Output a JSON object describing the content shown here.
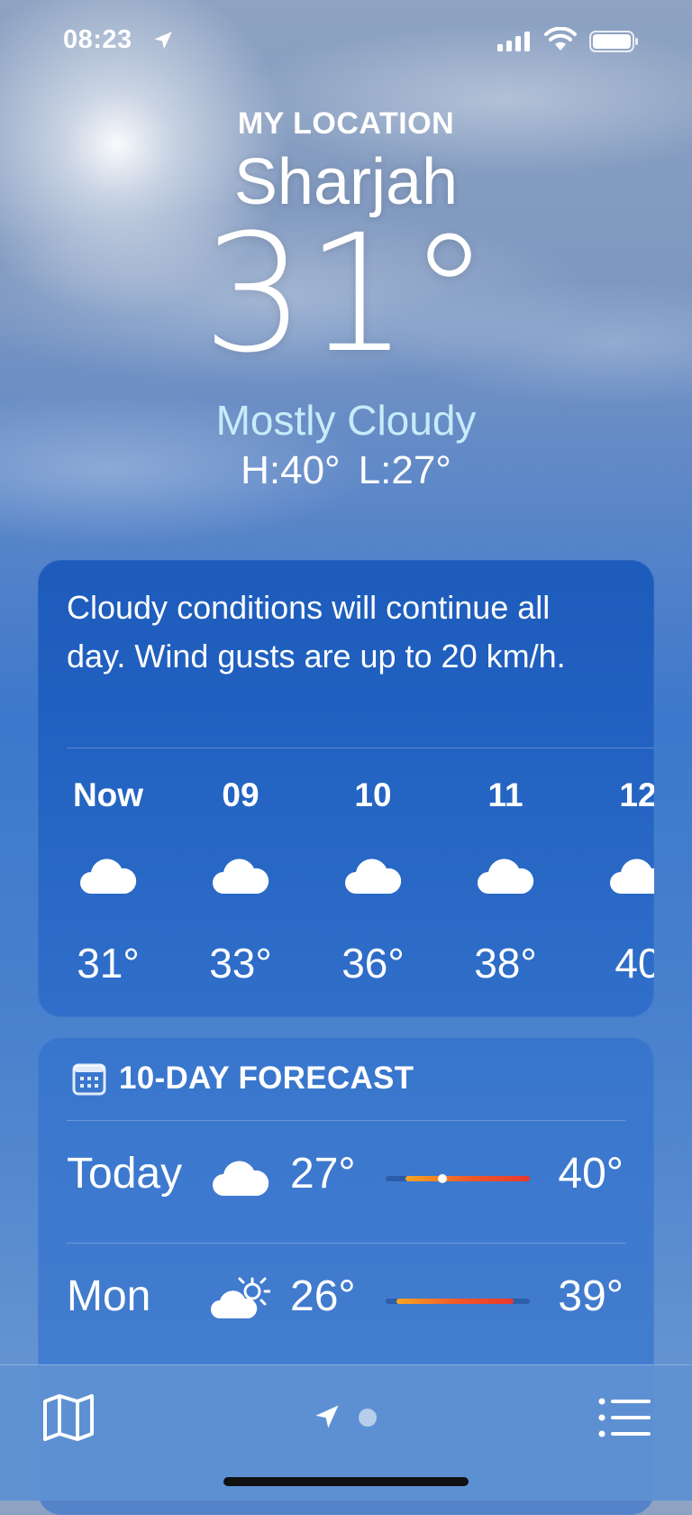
{
  "status_bar": {
    "time": "08:23",
    "icons": [
      "location-arrow-icon",
      "signal-icon",
      "wifi-icon",
      "battery-icon"
    ]
  },
  "header": {
    "location_label": "MY LOCATION",
    "city": "Sharjah",
    "temperature": "31°",
    "condition": "Mostly Cloudy",
    "high": "H:40°",
    "low": "L:27°"
  },
  "hourly_card": {
    "summary": "Cloudy conditions will continue all day. Wind gusts are up to 20 km/h.",
    "hours": [
      {
        "label": "Now",
        "icon": "cloud-icon",
        "temp": "31°"
      },
      {
        "label": "09",
        "icon": "cloud-icon",
        "temp": "33°"
      },
      {
        "label": "10",
        "icon": "cloud-icon",
        "temp": "36°"
      },
      {
        "label": "11",
        "icon": "cloud-icon",
        "temp": "38°"
      },
      {
        "label": "12",
        "icon": "cloud-icon",
        "temp": "40"
      }
    ]
  },
  "forecast_card": {
    "title": "10-DAY FORECAST",
    "icon": "calendar-icon",
    "days": [
      {
        "day": "Today",
        "icon": "cloud-icon",
        "low": "27°",
        "high": "40°",
        "current_marker": true
      },
      {
        "day": "Mon",
        "icon": "partly-sunny-icon",
        "low": "26°",
        "high": "39°",
        "current_marker": false
      }
    ]
  },
  "bottom_bar": {
    "icons": [
      "map-icon",
      "location-arrow-icon",
      "page-dot",
      "list-icon"
    ]
  },
  "colors": {
    "condition_text": "#c7ebf8",
    "range_bar_start": "#f5a623",
    "range_bar_end": "#e8392d"
  }
}
